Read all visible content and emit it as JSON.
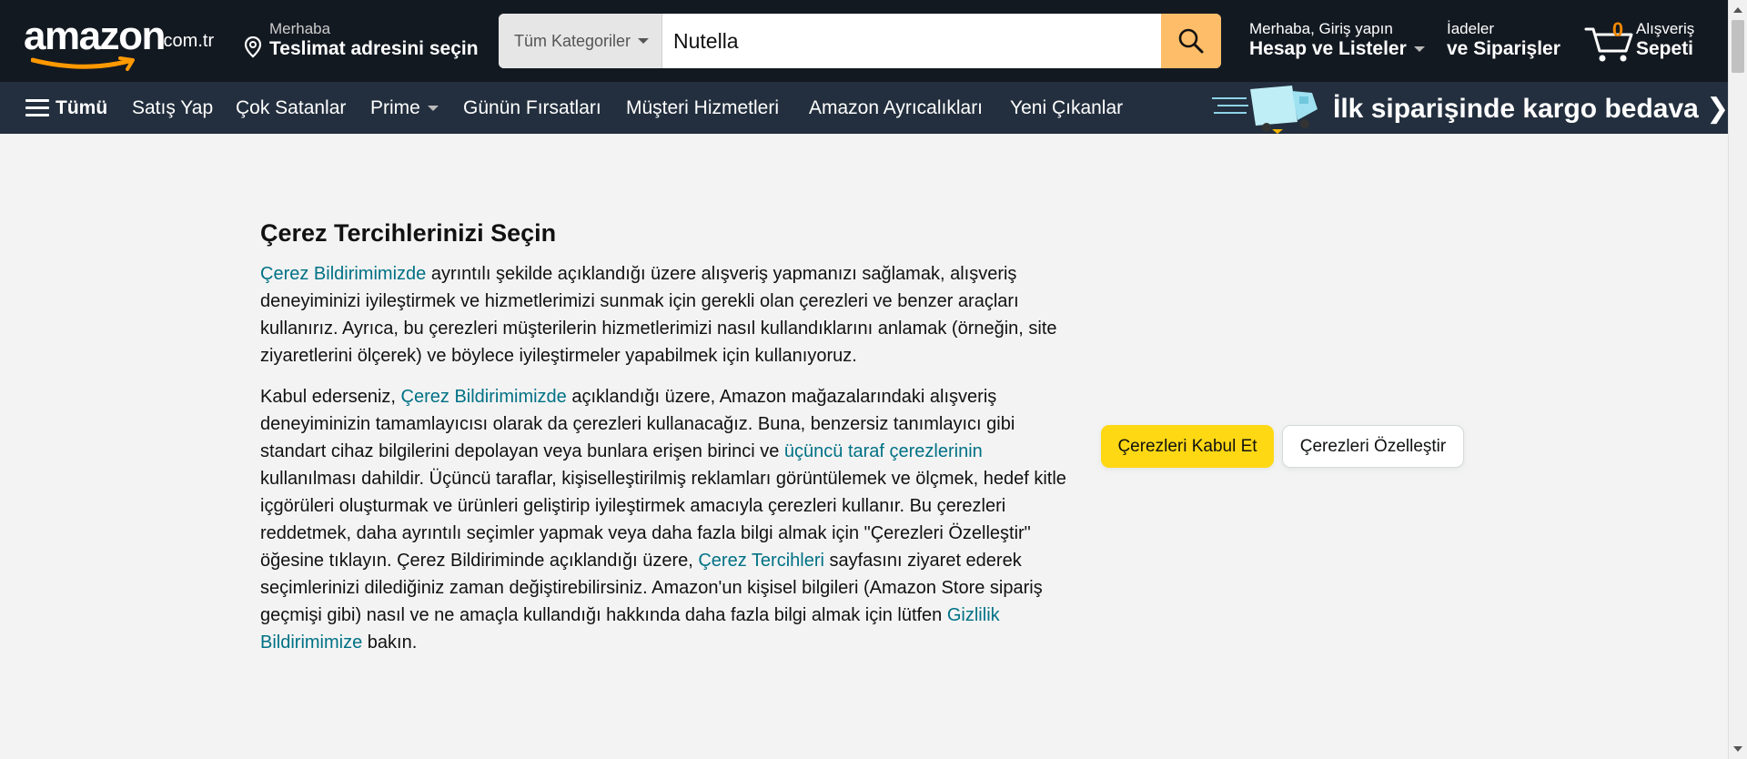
{
  "header": {
    "logo_text": "amazon",
    "logo_tld": ".com.tr",
    "deliver_line1": "Merhaba",
    "deliver_line2": "Teslimat adresini seçin",
    "search_category": "Tüm Kategoriler",
    "search_value": "Nutella",
    "account_line1": "Merhaba, Giriş yapın",
    "account_line2": "Hesap ve Listeler",
    "orders_line1": "İadeler",
    "orders_line2": "ve Siparişler",
    "cart_count": "0",
    "cart_line1": "Alışveriş",
    "cart_line2": "Sepeti"
  },
  "subnav": {
    "all": "Tümü",
    "items": [
      "Satış Yap",
      "Çok Satanlar",
      "Prime",
      "Günün Fırsatları",
      "Müşteri Hizmetleri",
      "Amazon Ayrıcalıkları",
      "Yeni Çıkanlar"
    ],
    "promo": "İlk siparişinde kargo bedava ❯"
  },
  "cookie": {
    "title": "Çerez Tercihlerinizi Seçin",
    "p1_link": "Çerez Bildirimimizde",
    "p1_text": " ayrıntılı şekilde açıklandığı üzere alışveriş yapmanızı sağlamak, alışveriş deneyiminizi iyileştirmek ve hizmetlerimizi sunmak için gerekli olan çerezleri ve benzer araçları kullanırız. Ayrıca, bu çerezleri müşterilerin hizmetlerimizi nasıl kullandıklarını anlamak (örneğin, site ziyaretlerini ölçerek) ve böylece iyileştirmeler yapabilmek için kullanıyoruz.",
    "p2_a": "Kabul ederseniz, ",
    "p2_link1": "Çerez Bildirimimizde",
    "p2_b": " açıklandığı üzere, Amazon mağazalarındaki alışveriş deneyiminizin tamamlayıcısı olarak da çerezleri kullanacağız. Buna, benzersiz tanımlayıcı gibi standart cihaz bilgilerini depolayan veya bunlara erişen birinci ve ",
    "p2_link2": "üçüncü taraf çerezlerinin",
    "p2_c": " kullanılması dahildir. Üçüncü taraflar, kişiselleştirilmiş reklamları görüntülemek ve ölçmek, hedef kitle içgörüleri oluşturmak ve ürünleri geliştirip iyileştirmek amacıyla çerezleri kullanır. Bu çerezleri reddetmek, daha ayrıntılı seçimler yapmak veya daha fazla bilgi almak için \"Çerezleri Özelleştir\" öğesine tıklayın. Çerez Bildiriminde açıklandığı üzere, ",
    "p2_link3": "Çerez Tercihleri",
    "p2_d": " sayfasını ziyaret ederek seçimlerinizi dilediğiniz zaman değiştirebilirsiniz. Amazon'un kişisel bilgileri (Amazon Store sipariş geçmişi gibi) nasıl ve ne amaçla kullandığı hakkında daha fazla bilgi almak için lütfen ",
    "p2_link4": "Gizlilik Bildirimimize",
    "p2_e": " bakın.",
    "accept_label": "Çerezleri Kabul Et",
    "customize_label": "Çerezleri Özelleştir"
  },
  "colors": {
    "nav_bg": "#131921",
    "subnav_bg": "#232f3e",
    "search_button": "#febd69",
    "accept_button": "#ffd814",
    "link": "#007185",
    "cart_count": "#f08804"
  },
  "icons": [
    "location-pin-icon",
    "chevron-down-icon",
    "search-icon",
    "cart-icon",
    "hamburger-menu-icon",
    "delivery-truck-icon"
  ]
}
